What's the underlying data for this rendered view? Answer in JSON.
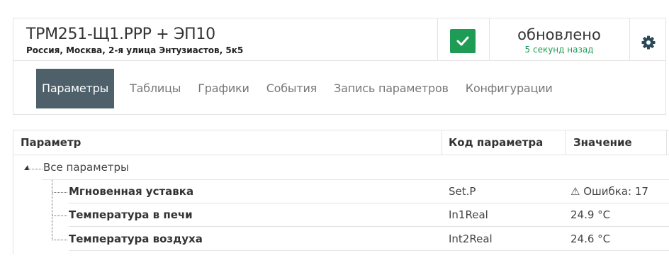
{
  "device": {
    "title": "ТРМ251-Щ1.РРР + ЭП10",
    "address": "Россия, Москва, 2-я улица Энтузиастов, 5к5"
  },
  "status": {
    "main": "обновлено",
    "sub": "5 секунд назад"
  },
  "colors": {
    "accent_green": "#1e9b55",
    "active_tab_bg": "#4e616a",
    "gear": "#2a4a5a"
  },
  "icons": {
    "check": "check-icon",
    "settings": "gear-icon",
    "warning": "warning-icon"
  },
  "tabs": [
    {
      "label": "Параметры",
      "active": true
    },
    {
      "label": "Таблицы",
      "active": false
    },
    {
      "label": "Графики",
      "active": false
    },
    {
      "label": "События",
      "active": false
    },
    {
      "label": "Запись параметров",
      "active": false
    },
    {
      "label": "Конфигурации",
      "active": false
    }
  ],
  "table": {
    "headers": {
      "param": "Параметр",
      "code": "Код параметра",
      "value": "Значение"
    },
    "root": "Все параметры",
    "rows": [
      {
        "name": "Мгновенная уставка",
        "code": "Set.P",
        "value": "⚠ Ошибка: 17"
      },
      {
        "name": "Температура в печи",
        "code": "In1Real",
        "value": "24.9 °C"
      },
      {
        "name": "Температура воздуха",
        "code": "Int2Real",
        "value": "24.6 °C"
      }
    ]
  }
}
